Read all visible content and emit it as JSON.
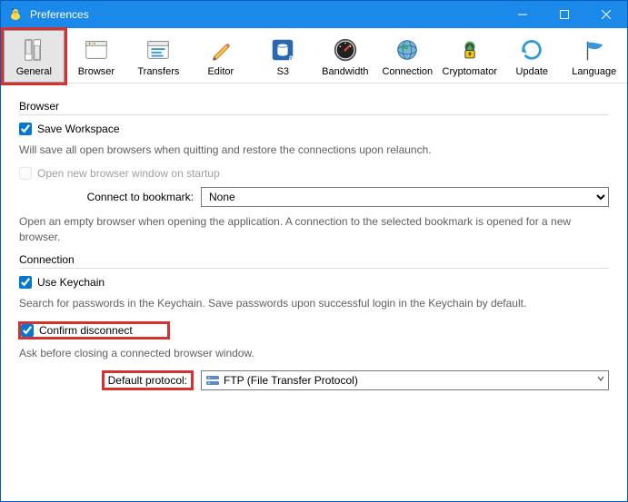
{
  "window": {
    "title": "Preferences"
  },
  "toolbar": [
    {
      "label": "General"
    },
    {
      "label": "Browser"
    },
    {
      "label": "Transfers"
    },
    {
      "label": "Editor"
    },
    {
      "label": "S3"
    },
    {
      "label": "Bandwidth"
    },
    {
      "label": "Connection"
    },
    {
      "label": "Cryptomator"
    },
    {
      "label": "Update"
    },
    {
      "label": "Language"
    }
  ],
  "browser_section": {
    "header": "Browser",
    "save_workspace_label": "Save Workspace",
    "save_workspace_desc": "Will save all open browsers when quitting and restore the connections upon relaunch.",
    "open_new_label": "Open new browser window on startup",
    "connect_label": "Connect to bookmark:",
    "connect_value": "None",
    "connect_desc": "Open an empty browser when opening the application. A connection to the selected bookmark is opened for a new browser."
  },
  "connection_section": {
    "header": "Connection",
    "keychain_label": "Use Keychain",
    "keychain_desc": "Search for passwords in the Keychain. Save passwords upon successful login in the Keychain by default.",
    "confirm_label": "Confirm disconnect",
    "confirm_desc": "Ask before closing a connected browser window.",
    "protocol_label": "Default protocol:",
    "protocol_value": "FTP (File Transfer Protocol)"
  }
}
